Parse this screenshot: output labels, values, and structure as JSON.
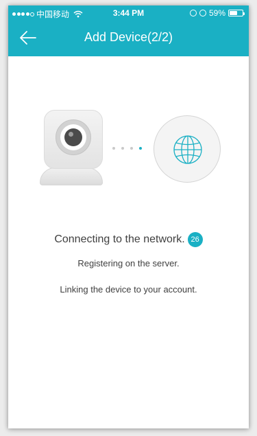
{
  "colors": {
    "accent": "#1ab0c4",
    "text": "#3f3f3f"
  },
  "status_bar": {
    "carrier": "中国移动",
    "time": "3:44 PM",
    "battery_percent": "59%",
    "battery_level": 0.59,
    "icons": [
      "signal-icon",
      "wifi-icon",
      "orientation-lock-icon",
      "alarm-icon",
      "battery-icon"
    ]
  },
  "nav": {
    "back_icon": "arrow-left-icon",
    "title": "Add Device(2/2)"
  },
  "illustration": {
    "left_icon": "camera-icon",
    "right_icon": "globe-icon",
    "progress_dots": 4,
    "active_dot": 4
  },
  "steps": {
    "connecting": "Connecting to the network.",
    "countdown": "26",
    "registering": "Registering on the server.",
    "linking": "Linking the device to your account."
  }
}
